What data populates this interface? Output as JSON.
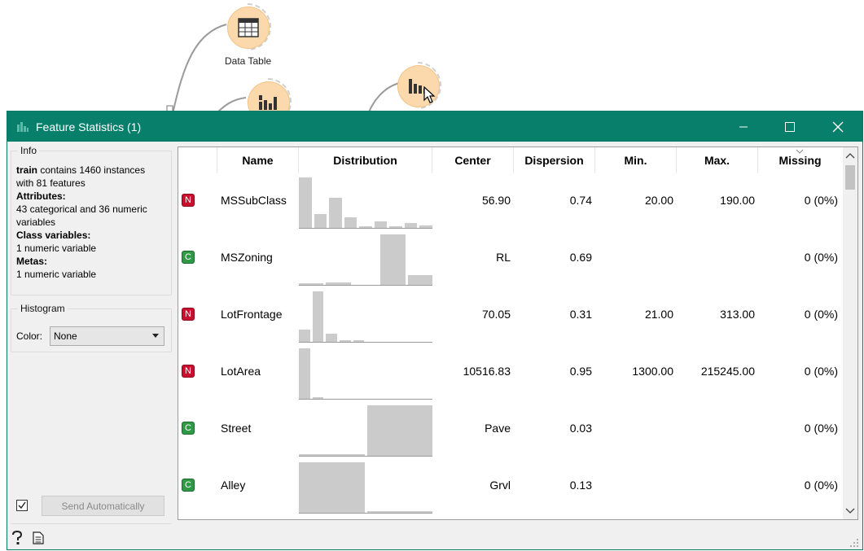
{
  "canvas": {
    "data_table_label": "Data Table"
  },
  "window": {
    "title": "Feature Statistics (1)"
  },
  "info": {
    "group_title": "Info",
    "dataset_name": "train",
    "dataset_desc": " contains 1460 instances",
    "dataset_desc2": "with 81 features",
    "attributes_label": "Attributes:",
    "attributes_value1": "43 categorical and 36 numeric",
    "attributes_value2": "variables",
    "class_label": "Class variables:",
    "class_value": "1 numeric variable",
    "metas_label": "Metas:",
    "metas_value": "1 numeric variable"
  },
  "histogram": {
    "group_title": "Histogram",
    "color_label": "Color:",
    "color_value": "None"
  },
  "send": {
    "checked": true,
    "label": "Send Automatically"
  },
  "table": {
    "headers": [
      "Name",
      "Distribution",
      "Center",
      "Dispersion",
      "Min.",
      "Max.",
      "Missing"
    ],
    "rows": [
      {
        "type": "N",
        "name": "MSSubClass",
        "center": "56.90",
        "dispersion": "0.74",
        "min": "20.00",
        "max": "190.00",
        "missing": "0 (0%)",
        "hist": [
          1.0,
          0.27,
          0.6,
          0.21,
          0.02,
          0.13,
          0.02,
          0.1,
          0.05
        ]
      },
      {
        "type": "C",
        "name": "MSZoning",
        "center": "RL",
        "dispersion": "0.69",
        "min": "",
        "max": "",
        "missing": "0 (0%)",
        "hist": [
          0.01,
          0.05,
          0.0,
          1.0,
          0.19
        ]
      },
      {
        "type": "N",
        "name": "LotFrontage",
        "center": "70.05",
        "dispersion": "0.31",
        "min": "21.00",
        "max": "313.00",
        "missing": "0 (0%)",
        "hist": [
          0.24,
          1.0,
          0.16,
          0.03,
          0.01,
          0.0,
          0.0,
          0.0,
          0.0,
          0.0
        ]
      },
      {
        "type": "N",
        "name": "LotArea",
        "center": "10516.83",
        "dispersion": "0.95",
        "min": "1300.00",
        "max": "215245.00",
        "missing": "0 (0%)",
        "hist": [
          1.0,
          0.01,
          0.0,
          0.0,
          0.0,
          0.0,
          0.0,
          0.0,
          0.0,
          0.0
        ]
      },
      {
        "type": "C",
        "name": "Street",
        "center": "Pave",
        "dispersion": "0.03",
        "min": "",
        "max": "",
        "missing": "0 (0%)",
        "hist": [
          0.004,
          1.0
        ]
      },
      {
        "type": "C",
        "name": "Alley",
        "center": "Grvl",
        "dispersion": "0.13",
        "min": "",
        "max": "",
        "missing": "0 (0%)",
        "hist": [
          1.0,
          0.02
        ]
      }
    ]
  },
  "colors": {
    "titlebar": "#087f6b",
    "numeric_badge": "#c8102e",
    "categorical_badge": "#2e9a46",
    "node_fill": "#fbd9ac",
    "bar_fill": "#cbcbcb"
  },
  "icons": {
    "title": "feature-statistics-icon",
    "minimize": "minimize-icon",
    "maximize": "maximize-icon",
    "close": "close-icon",
    "help": "help-icon",
    "report": "report-icon"
  }
}
